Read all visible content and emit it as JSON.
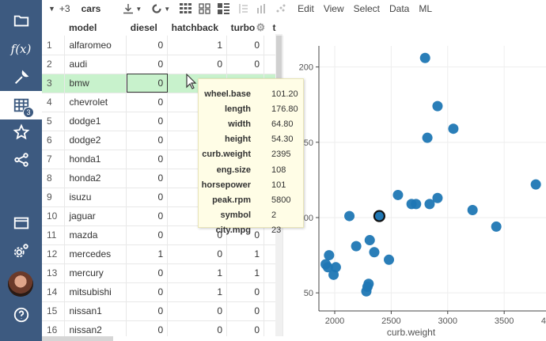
{
  "sidebar": {
    "items": [
      {
        "name": "folder-icon"
      },
      {
        "name": "function-icon"
      },
      {
        "name": "wrench-icon"
      },
      {
        "name": "table-icon",
        "badge": "3",
        "active": true
      },
      {
        "name": "star-icon"
      },
      {
        "name": "share-icon"
      },
      {
        "name": "window-icon"
      },
      {
        "name": "settings-icon"
      },
      {
        "name": "help-icon"
      }
    ]
  },
  "toolbar": {
    "tables_count": "+3",
    "table_name": "cars",
    "menus": [
      "Edit",
      "View",
      "Select",
      "Data",
      "ML"
    ]
  },
  "grid": {
    "columns": [
      "model",
      "diesel",
      "hatchback",
      "turbo",
      "t"
    ],
    "selected_row": 3,
    "rows": [
      {
        "n": "1",
        "model": "alfaromeo",
        "diesel": "0",
        "hatchback": "1",
        "turbo": "0"
      },
      {
        "n": "2",
        "model": "audi",
        "diesel": "0",
        "hatchback": "0",
        "turbo": "0"
      },
      {
        "n": "3",
        "model": "bmw",
        "diesel": "0",
        "hatchback": "",
        "turbo": ""
      },
      {
        "n": "4",
        "model": "chevrolet",
        "diesel": "0",
        "hatchback": "",
        "turbo": ""
      },
      {
        "n": "5",
        "model": "dodge1",
        "diesel": "0",
        "hatchback": "",
        "turbo": ""
      },
      {
        "n": "6",
        "model": "dodge2",
        "diesel": "0",
        "hatchback": "",
        "turbo": ""
      },
      {
        "n": "7",
        "model": "honda1",
        "diesel": "0",
        "hatchback": "",
        "turbo": ""
      },
      {
        "n": "8",
        "model": "honda2",
        "diesel": "0",
        "hatchback": "",
        "turbo": ""
      },
      {
        "n": "9",
        "model": "isuzu",
        "diesel": "0",
        "hatchback": "",
        "turbo": ""
      },
      {
        "n": "10",
        "model": "jaguar",
        "diesel": "0",
        "hatchback": "",
        "turbo": ""
      },
      {
        "n": "11",
        "model": "mazda",
        "diesel": "0",
        "hatchback": "0",
        "turbo": "0"
      },
      {
        "n": "12",
        "model": "mercedes",
        "diesel": "1",
        "hatchback": "0",
        "turbo": "1"
      },
      {
        "n": "13",
        "model": "mercury",
        "diesel": "0",
        "hatchback": "1",
        "turbo": "1"
      },
      {
        "n": "14",
        "model": "mitsubishi",
        "diesel": "0",
        "hatchback": "1",
        "turbo": "0"
      },
      {
        "n": "15",
        "model": "nissan1",
        "diesel": "0",
        "hatchback": "0",
        "turbo": "0"
      },
      {
        "n": "16",
        "model": "nissan2",
        "diesel": "0",
        "hatchback": "0",
        "turbo": "0"
      }
    ]
  },
  "tooltip": [
    {
      "k": "wheel.base",
      "v": "101.20"
    },
    {
      "k": "length",
      "v": "176.80"
    },
    {
      "k": "width",
      "v": "64.80"
    },
    {
      "k": "height",
      "v": "54.30"
    },
    {
      "k": "curb.weight",
      "v": "2395"
    },
    {
      "k": "eng.size",
      "v": "108"
    },
    {
      "k": "horsepower",
      "v": "101"
    },
    {
      "k": "peak.rpm",
      "v": "5800"
    },
    {
      "k": "symbol",
      "v": "2"
    },
    {
      "k": "city.mpg",
      "v": "23"
    }
  ],
  "chart_data": {
    "type": "scatter",
    "xlabel": "curb.weight",
    "ylabel": "",
    "xlim": [
      1860,
      3870
    ],
    "ylim": [
      38,
      214
    ],
    "xticks": [
      2000,
      2500,
      3000,
      3500
    ],
    "xtick_labels": [
      "2000",
      "2500",
      "3000",
      "3500",
      "4"
    ],
    "yticks": [
      50,
      100,
      150,
      200
    ],
    "ytick_labels": [
      "50",
      "00",
      "50",
      "200"
    ],
    "color": "#1f77b4",
    "highlight": {
      "x": 2395,
      "y": 101
    },
    "points": [
      [
        2800,
        206
      ],
      [
        2910,
        174
      ],
      [
        3050,
        159
      ],
      [
        2820,
        153
      ],
      [
        3780,
        122
      ],
      [
        2560,
        115
      ],
      [
        2680,
        109
      ],
      [
        2720,
        109
      ],
      [
        2840,
        109
      ],
      [
        2910,
        113
      ],
      [
        3220,
        105
      ],
      [
        3430,
        94
      ],
      [
        2130,
        101
      ],
      [
        2395,
        101
      ],
      [
        2310,
        85
      ],
      [
        2190,
        81
      ],
      [
        2350,
        77
      ],
      [
        2480,
        72
      ],
      [
        1950,
        75
      ],
      [
        1920,
        69
      ],
      [
        1940,
        67
      ],
      [
        2010,
        67
      ],
      [
        1990,
        62
      ],
      [
        2300,
        56
      ],
      [
        2290,
        54
      ],
      [
        2280,
        51
      ]
    ]
  }
}
